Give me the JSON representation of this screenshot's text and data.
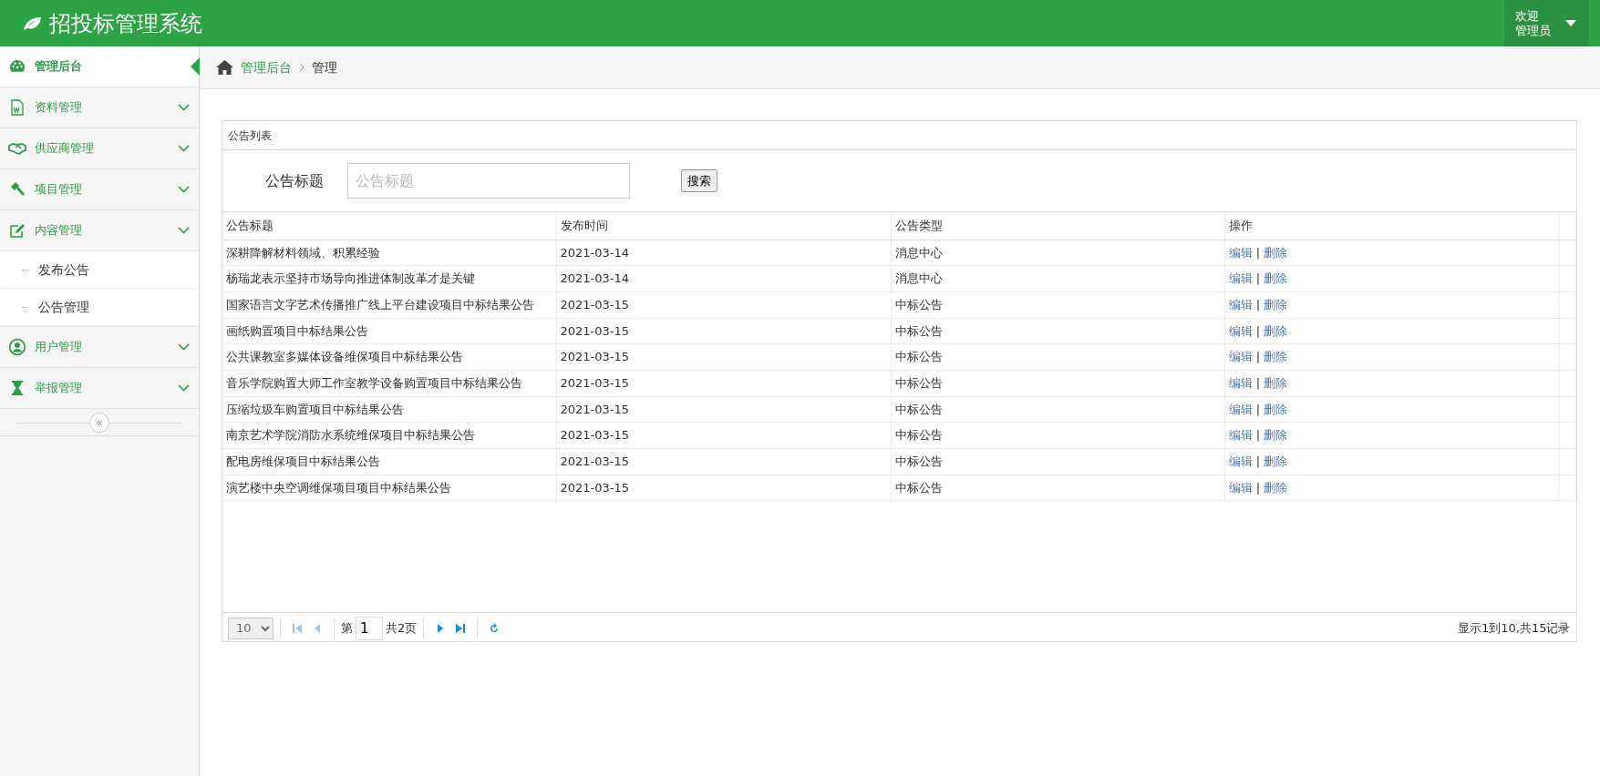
{
  "header": {
    "title": "招投标管理系统",
    "user_greeting": "欢迎",
    "user_name": "管理员"
  },
  "sidebar": {
    "items": [
      {
        "label": "管理后台",
        "selected": true,
        "expandable": false
      },
      {
        "label": "资料管理",
        "selected": false,
        "expandable": true
      },
      {
        "label": "供应商管理",
        "selected": false,
        "expandable": true
      },
      {
        "label": "项目管理",
        "selected": false,
        "expandable": true
      },
      {
        "label": "内容管理",
        "selected": false,
        "expandable": true,
        "children": [
          {
            "label": "发布公告",
            "selected": false
          },
          {
            "label": "公告管理",
            "selected": false
          }
        ]
      },
      {
        "label": "用户管理",
        "selected": false,
        "expandable": true
      },
      {
        "label": "举报管理",
        "selected": false,
        "expandable": true
      }
    ],
    "collapse_button": "«"
  },
  "breadcrumb": {
    "link": "管理后台",
    "current": "管理"
  },
  "panel": {
    "title": "公告列表",
    "search": {
      "label": "公告标题",
      "placeholder": "公告标题",
      "button": "搜索"
    },
    "table": {
      "columns": [
        "公告标题",
        "发布时间",
        "公告类型",
        "操作"
      ],
      "rows": [
        {
          "title": "深耕降解材料领域、积累经验",
          "date": "2021-03-14",
          "type": "消息中心",
          "edit": "编辑",
          "separator": "|",
          "delete": "删除"
        },
        {
          "title": "杨瑞龙表示坚持市场导向推进体制改革才是关键",
          "date": "2021-03-14",
          "type": "消息中心",
          "edit": "编辑",
          "separator": "|",
          "delete": "删除"
        },
        {
          "title": "国家语言文字艺术传播推广线上平台建设项目中标结果公告",
          "date": "2021-03-15",
          "type": "中标公告",
          "edit": "编辑",
          "separator": "|",
          "delete": "删除"
        },
        {
          "title": "画纸购置项目中标结果公告",
          "date": "2021-03-15",
          "type": "中标公告",
          "edit": "编辑",
          "separator": "|",
          "delete": "删除"
        },
        {
          "title": "公共课教室多媒体设备维保项目中标结果公告",
          "date": "2021-03-15",
          "type": "中标公告",
          "edit": "编辑",
          "separator": "|",
          "delete": "删除"
        },
        {
          "title": "音乐学院购置大师工作室教学设备购置项目中标结果公告",
          "date": "2021-03-15",
          "type": "中标公告",
          "edit": "编辑",
          "separator": "|",
          "delete": "删除"
        },
        {
          "title": "压缩垃圾车购置项目中标结果公告",
          "date": "2021-03-15",
          "type": "中标公告",
          "edit": "编辑",
          "separator": "|",
          "delete": "删除"
        },
        {
          "title": "南京艺术学院消防水系统维保项目中标结果公告",
          "date": "2021-03-15",
          "type": "中标公告",
          "edit": "编辑",
          "separator": "|",
          "delete": "删除"
        },
        {
          "title": "配电房维保项目中标结果公告",
          "date": "2021-03-15",
          "type": "中标公告",
          "edit": "编辑",
          "separator": "|",
          "delete": "删除"
        },
        {
          "title": "演艺楼中央空调维保项目项目中标结果公告",
          "date": "2021-03-15",
          "type": "中标公告",
          "edit": "编辑",
          "separator": "|",
          "delete": "删除"
        }
      ]
    },
    "pagination": {
      "page_size": "10",
      "page_prefix": "第",
      "page": "1",
      "page_total": "共2页",
      "summary": "显示1到10,共15记录"
    }
  }
}
